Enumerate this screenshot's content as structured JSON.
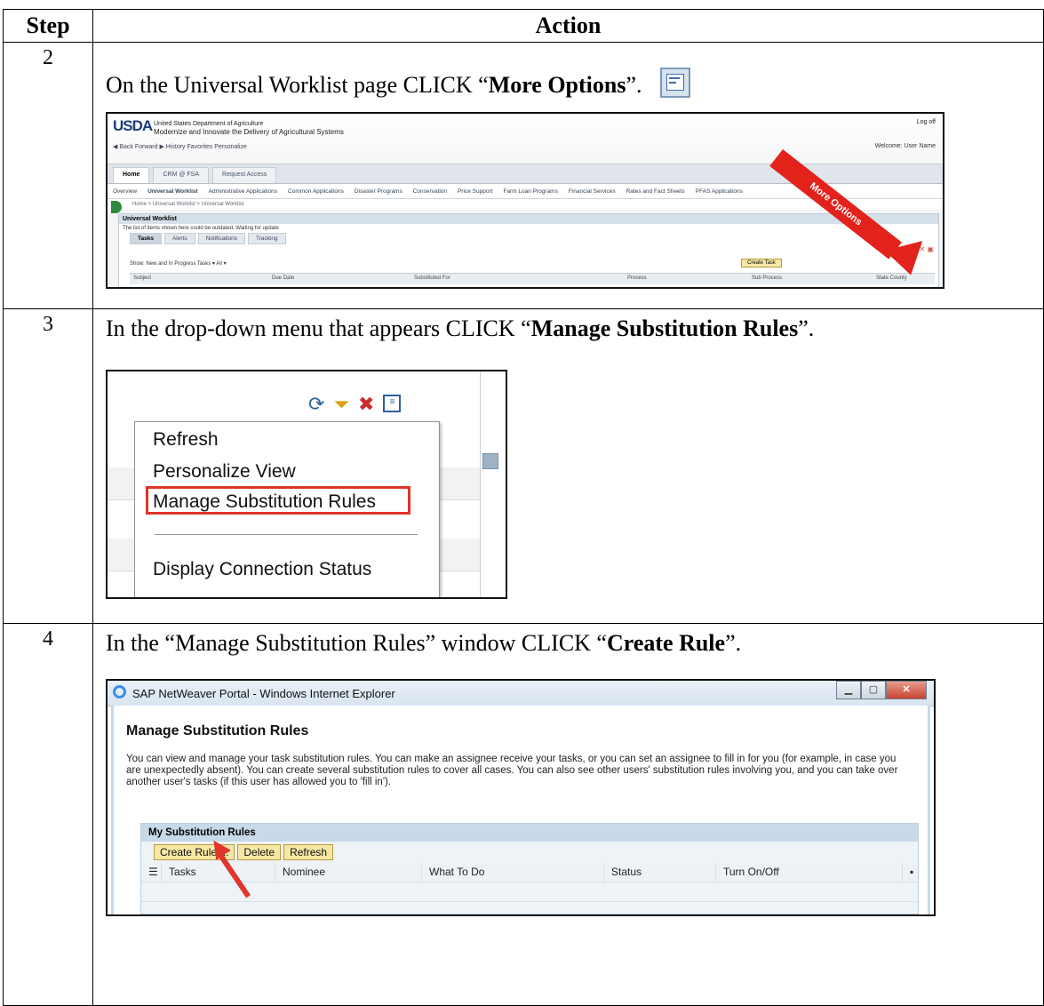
{
  "table": {
    "header_step": "Step",
    "header_action": "Action"
  },
  "rows": [
    {
      "step": "2",
      "text_before": "On the Universal Worklist page CLICK “",
      "bold": "More Options",
      "text_after": "”.",
      "icon": "more-options-icon"
    },
    {
      "step": "3",
      "text_before": "In the drop-down menu that appears CLICK “",
      "bold": "Manage Substitution Rules",
      "text_after": "”."
    },
    {
      "step": "4",
      "text_before": "In the “Manage Substitution Rules” window CLICK “",
      "bold": "Create Rule",
      "text_after": "”."
    }
  ],
  "shot1": {
    "logo": "USDA",
    "dept_line1": "United States Department of Agriculture",
    "dept_line2": "Modernize and Innovate the Delivery of Agricultural Systems",
    "nav": "◀ Back  Forward ▶   History   Favorites   Personalize",
    "log_off": "Log off",
    "welcome": "Welcome: User Name",
    "tabs": [
      "Home",
      "CRM @ FSA",
      "Request Access"
    ],
    "subnav": [
      "Overview",
      "Universal Worklist",
      "Administrative Applications",
      "Common Applications",
      "Disaster Programs",
      "Conservation",
      "Price Support",
      "Farm Loan Programs",
      "Financial Services",
      "Rates and Fact Sheets",
      "PFAS Applications"
    ],
    "breadcrumb": "Home  >  Universal Worklist  >  Universal Worklist",
    "uwl_title": "Universal Worklist",
    "uwl_msg": "The list of items shown here could be outdated. Waiting for update",
    "uwl_tabs": [
      "Tasks",
      "Alerts",
      "Notifications",
      "Tracking"
    ],
    "show_label": "Show: New and In Progress Tasks  ▾  All  ▾",
    "create_task": "Create Task",
    "columns": [
      "Subject",
      "Due Date",
      "Substituted For",
      "Process",
      "Sub Process",
      "State   County"
    ],
    "ribbon": "More Options"
  },
  "shot2": {
    "menu_items": [
      "Refresh",
      "Personalize View",
      "Manage Substitution Rules",
      "Display Connection Status"
    ]
  },
  "shot3": {
    "window_title": "SAP NetWeaver Portal - Windows Internet Explorer",
    "heading": "Manage Substitution Rules",
    "description": "You can view and manage your task substitution rules. You can make an assignee receive your tasks, or you can set an assignee to fill in for you (for example, in case you are unexpectedly absent). You can create several substitution rules to cover all cases. You can also see other users' substitution rules involving you, and you can take over another user's tasks (if this user has allowed you to 'fill in').",
    "section_title": "My Substitution Rules",
    "buttons": [
      "Create Rule ...",
      "Delete",
      "Refresh"
    ],
    "columns": [
      "Tasks",
      "Nominee",
      "What To Do",
      "Status",
      "Turn On/Off"
    ]
  }
}
